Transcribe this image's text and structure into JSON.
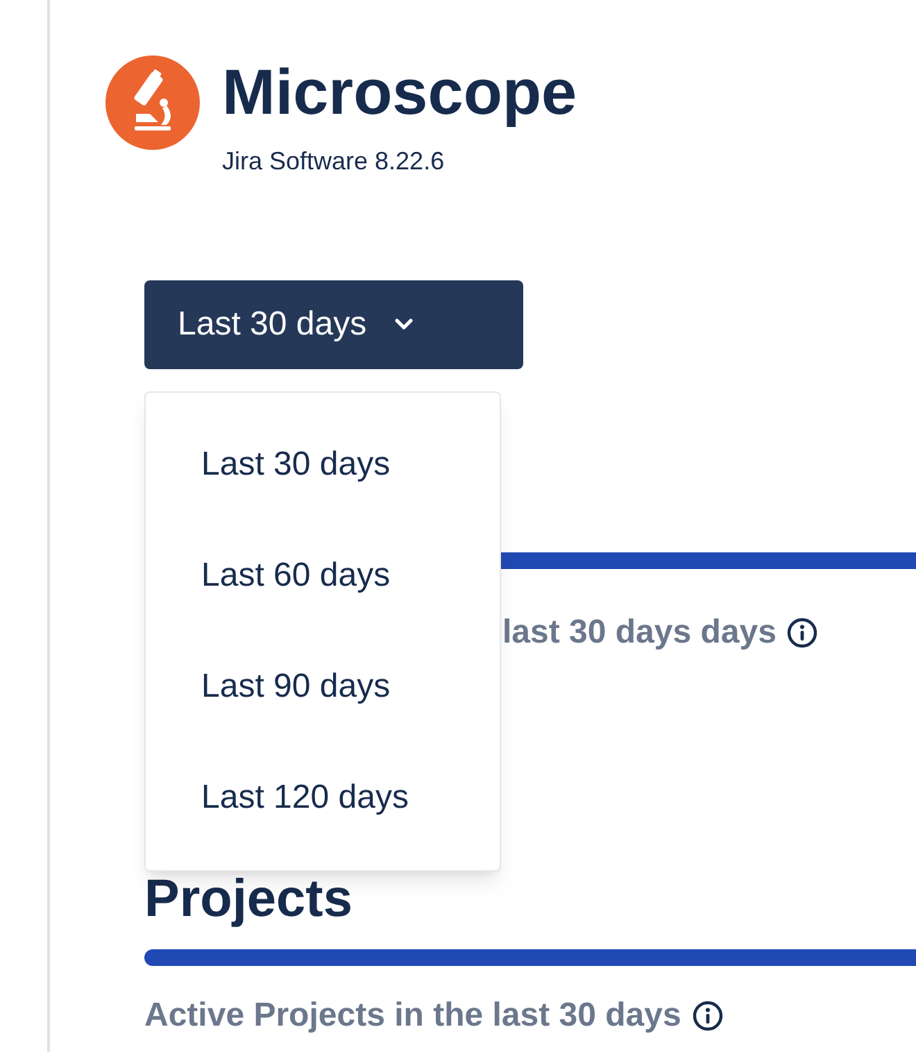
{
  "app": {
    "title": "Microscope",
    "subtitle": "Jira Software 8.22.6"
  },
  "period_dropdown": {
    "value": "Last 30 days",
    "expanded": true,
    "options": [
      {
        "label": "Last 30 days"
      },
      {
        "label": "Last 60 days"
      },
      {
        "label": "Last 90 days"
      },
      {
        "label": "Last 120 days"
      }
    ]
  },
  "sections": [
    {
      "stat_label": "last 30 days days"
    },
    {
      "heading": "Projects",
      "stat_label": "Active Projects in the last 30 days"
    }
  ]
}
